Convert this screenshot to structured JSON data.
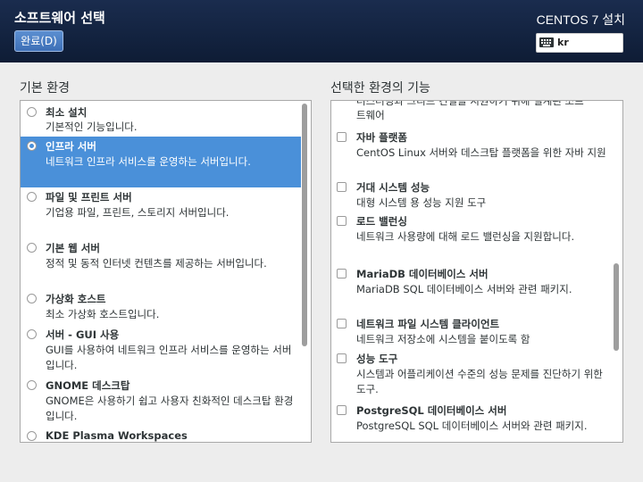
{
  "header": {
    "title": "소프트웨어 선택",
    "done_label": "완료(D)",
    "product": "CENTOS 7 설치",
    "keyboard_layout": "kr"
  },
  "base_env": {
    "label": "기본 환경",
    "selected_index": 1,
    "items": [
      {
        "title": "최소 설치",
        "desc": "기본적인 기능입니다."
      },
      {
        "title": "인프라 서버",
        "desc": "네트워크 인프라 서비스를 운영하는 서버입니다."
      },
      {
        "title": "파일 및 프린트 서버",
        "desc": "기업용 파일, 프린트, 스토리지 서버입니다."
      },
      {
        "title": "기본 웹 서버",
        "desc": "정적 및 동적 인터넷 컨텐츠를 제공하는 서버입니다."
      },
      {
        "title": "가상화 호스트",
        "desc": "최소 가상화 호스트입니다."
      },
      {
        "title": "서버 - GUI 사용",
        "desc": "GUI를 사용하여 네트워크 인프라 서비스를 운영하는 서버입니다."
      },
      {
        "title": "GNOME 데스크탑",
        "desc": "GNOME은 사용하기 쉽고 사용자 친화적인 데스크탑 환경입니다."
      },
      {
        "title": "KDE Plasma Workspaces",
        "desc": ""
      }
    ]
  },
  "addons": {
    "label": "선택한 환경의 기능",
    "partial_top_line1": "터스터링과 그리드 컨널을 지원하기 위해 설계된 소프",
    "partial_top_line2": "트웨어",
    "items": [
      {
        "title": "자바 플랫폼",
        "desc": "CentOS Linux 서버와 데스크탑 플랫폼을 위한 자바 지원",
        "checked": false
      },
      {
        "title": "거대 시스템 성능",
        "desc": "대형 시스템 용 성능 지원 도구",
        "checked": false
      },
      {
        "title": "로드 밸런싱",
        "desc": "네트워크 사용량에 대해 로드 밸런싱을 지원합니다.",
        "checked": false
      },
      {
        "title": "MariaDB 데이터베이스 서버",
        "desc": "MariaDB SQL 데이터베이스 서버와 관련 패키지.",
        "checked": false
      },
      {
        "title": "네트워크 파일 시스템 클라이언트",
        "desc": "네트워크 저장소에 시스템을 붙이도록 함",
        "checked": false
      },
      {
        "title": "성능 도구",
        "desc": "시스템과 어플리케이션 수준의 성능 문제를 진단하기 위한 도구.",
        "checked": false
      },
      {
        "title": "PostgreSQL 데이터베이스 서버",
        "desc": "PostgreSQL SQL 데이터베이스 서버와 관련 패키지.",
        "checked": false
      }
    ]
  }
}
